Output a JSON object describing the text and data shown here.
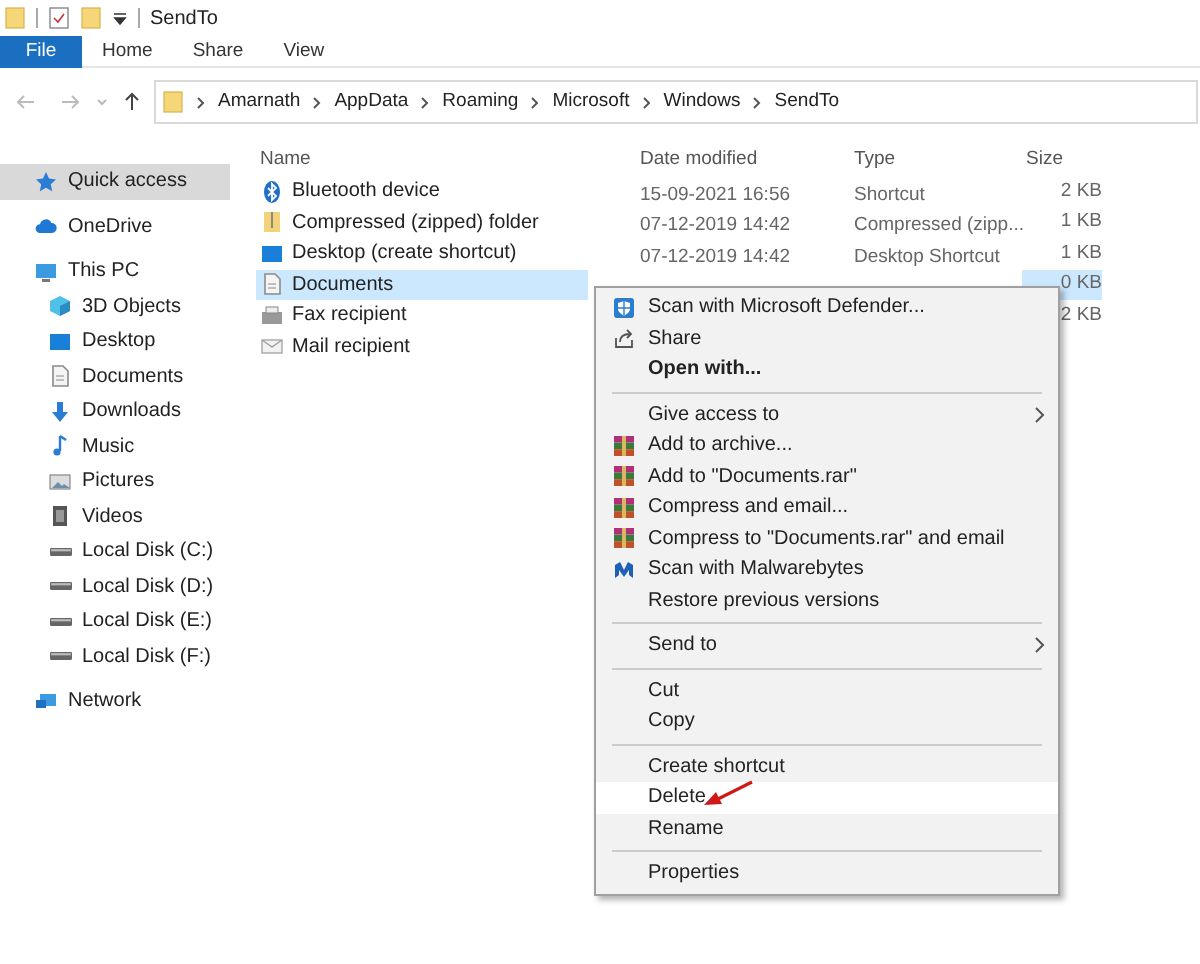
{
  "window": {
    "title": "SendTo"
  },
  "ribbon_tabs": [
    {
      "label": "File",
      "selected": true
    },
    {
      "label": "Home",
      "selected": false
    },
    {
      "label": "Share",
      "selected": false
    },
    {
      "label": "View",
      "selected": false
    }
  ],
  "breadcrumb": [
    "Amarnath",
    "AppData",
    "Roaming",
    "Microsoft",
    "Windows",
    "SendTo"
  ],
  "sidebar": {
    "items": [
      {
        "label": "Quick access",
        "kind": "star",
        "selected": true
      },
      {
        "label": "OneDrive",
        "kind": "cloud",
        "selected": false
      },
      {
        "label": "This PC",
        "kind": "pc",
        "selected": false,
        "children": [
          {
            "label": "3D Objects",
            "kind": "cube",
            "selected": false
          },
          {
            "label": "Desktop",
            "kind": "desktop",
            "selected": false
          },
          {
            "label": "Documents",
            "kind": "doc",
            "selected": false
          },
          {
            "label": "Downloads",
            "kind": "download",
            "selected": false
          },
          {
            "label": "Music",
            "kind": "music",
            "selected": false
          },
          {
            "label": "Pictures",
            "kind": "pictures",
            "selected": false
          },
          {
            "label": "Videos",
            "kind": "videos",
            "selected": false
          },
          {
            "label": "Local Disk (C:)",
            "kind": "disk",
            "selected": false
          },
          {
            "label": "Local Disk (D:)",
            "kind": "disk",
            "selected": false
          },
          {
            "label": "Local Disk (E:)",
            "kind": "disk",
            "selected": false
          },
          {
            "label": "Local Disk (F:)",
            "kind": "disk",
            "selected": false
          }
        ]
      },
      {
        "label": "Network",
        "kind": "network",
        "selected": false
      }
    ]
  },
  "table": {
    "columns": [
      "Name",
      "Date modified",
      "Type",
      "Size"
    ],
    "rows": [
      {
        "name": "Bluetooth device",
        "kind": "bluetooth",
        "date": "15-09-2021 16:56",
        "type": "Shortcut",
        "size": "2 KB",
        "selected": false
      },
      {
        "name": "Compressed (zipped) folder",
        "kind": "zip",
        "date": "07-12-2019 14:42",
        "type": "Compressed (zipp...",
        "size": "1 KB",
        "selected": false
      },
      {
        "name": "Desktop (create shortcut)",
        "kind": "desktop",
        "date": "07-12-2019 14:42",
        "type": "Desktop Shortcut",
        "size": "1 KB",
        "selected": false
      },
      {
        "name": "Documents",
        "kind": "doc",
        "size": "0 KB",
        "selected": true
      },
      {
        "name": "Fax recipient",
        "kind": "fax",
        "size": "2 KB",
        "selected": false
      },
      {
        "name": "Mail recipient",
        "kind": "mail",
        "selected": false
      }
    ]
  },
  "context_menu": {
    "sections": [
      [
        {
          "label": "Scan with Microsoft Defender...",
          "kind": "shield",
          "bold": false,
          "submenu": false,
          "selected": false
        },
        {
          "label": "Share",
          "kind": "share",
          "bold": false,
          "submenu": false,
          "selected": false
        },
        {
          "label": "Open with...",
          "kind": "plain",
          "bold": true,
          "submenu": false,
          "selected": false
        }
      ],
      [
        {
          "label": "Give access to",
          "kind": "plain",
          "bold": false,
          "submenu": true,
          "selected": false
        },
        {
          "label": "Add to archive...",
          "kind": "rar",
          "bold": false,
          "submenu": false,
          "selected": false
        },
        {
          "label": "Add to \"Documents.rar\"",
          "kind": "rar",
          "bold": false,
          "submenu": false,
          "selected": false
        },
        {
          "label": "Compress and email...",
          "kind": "rar",
          "bold": false,
          "submenu": false,
          "selected": false
        },
        {
          "label": "Compress to \"Documents.rar\" and email",
          "kind": "rar",
          "bold": false,
          "submenu": false,
          "selected": false
        },
        {
          "label": "Scan with Malwarebytes",
          "kind": "malware",
          "bold": false,
          "submenu": false,
          "selected": false
        },
        {
          "label": "Restore previous versions",
          "kind": "plain",
          "bold": false,
          "submenu": false,
          "selected": false
        }
      ],
      [
        {
          "label": "Send to",
          "kind": "plain",
          "bold": false,
          "submenu": true,
          "selected": false
        }
      ],
      [
        {
          "label": "Cut",
          "kind": "plain",
          "bold": false,
          "submenu": false,
          "selected": false
        },
        {
          "label": "Copy",
          "kind": "plain",
          "bold": false,
          "submenu": false,
          "selected": false
        }
      ],
      [
        {
          "label": "Create shortcut",
          "kind": "plain",
          "bold": false,
          "submenu": false,
          "selected": false
        },
        {
          "label": "Delete",
          "kind": "plain",
          "bold": false,
          "submenu": false,
          "selected": true
        },
        {
          "label": "Rename",
          "kind": "plain",
          "bold": false,
          "submenu": false,
          "selected": false
        }
      ],
      [
        {
          "label": "Properties",
          "kind": "plain",
          "bold": false,
          "submenu": false,
          "selected": false
        }
      ]
    ]
  }
}
